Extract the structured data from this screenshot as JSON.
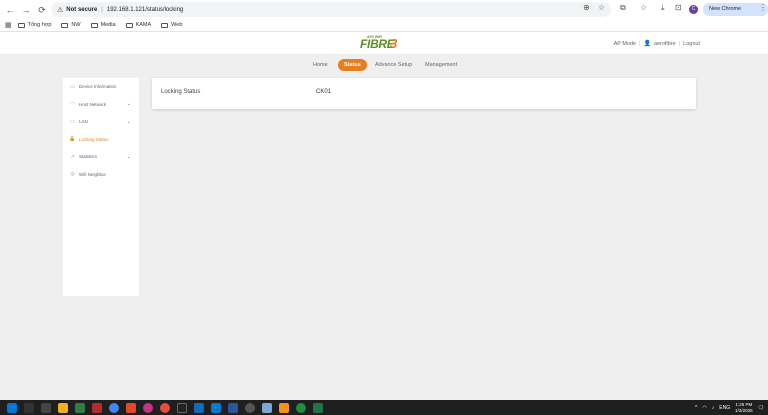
{
  "browser": {
    "back": "←",
    "forward": "→",
    "reload": "⟳",
    "security_icon": "⚠",
    "not_secure": "Not secure",
    "url": "192.168.1.121/status/locking",
    "profile_initial": "C",
    "new_chrome": "New Chrome available",
    "more": "⋮"
  },
  "bookmarks": {
    "apps": "▦",
    "items": [
      "Tổng hợp",
      "NW",
      "Media",
      "KAMA",
      "Web"
    ]
  },
  "header": {
    "logo_small": "AP3 WiFi",
    "logo_text": "FIBRE",
    "logo_num": "3",
    "mode": "AP Mode",
    "user": "aerofibre",
    "logout": "Logout"
  },
  "nav": {
    "home": "Home",
    "status": "Status",
    "advance": "Advance Setup",
    "management": "Management"
  },
  "sidebar": {
    "items": [
      {
        "label": "Device Information",
        "icon": "▭"
      },
      {
        "label": "Host Network",
        "icon": "◠"
      },
      {
        "label": "LAN",
        "icon": "▭"
      },
      {
        "label": "Locking Status",
        "icon": "🔒"
      },
      {
        "label": "Statistics",
        "icon": "↗"
      },
      {
        "label": "Wifi Neighbor",
        "icon": "◎"
      }
    ],
    "chevron": "⌄"
  },
  "content": {
    "label": "Locking Status",
    "value": "CK01"
  },
  "taskbar": {
    "lang": "ENG",
    "time": "1:25 PM",
    "date": "1/3/2026"
  }
}
